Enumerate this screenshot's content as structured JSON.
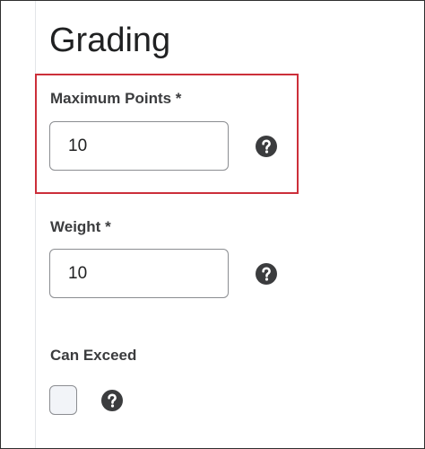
{
  "section": {
    "title": "Grading"
  },
  "fields": {
    "max_points": {
      "label": "Maximum Points *",
      "value": "10"
    },
    "weight": {
      "label": "Weight *",
      "value": "10"
    },
    "can_exceed": {
      "label": "Can Exceed",
      "checked": false
    }
  },
  "icons": {
    "help": "question-circle-icon"
  },
  "colors": {
    "highlight": "#cc2f3a",
    "icon": "#3b3c3e",
    "border": "#8b8d91"
  }
}
